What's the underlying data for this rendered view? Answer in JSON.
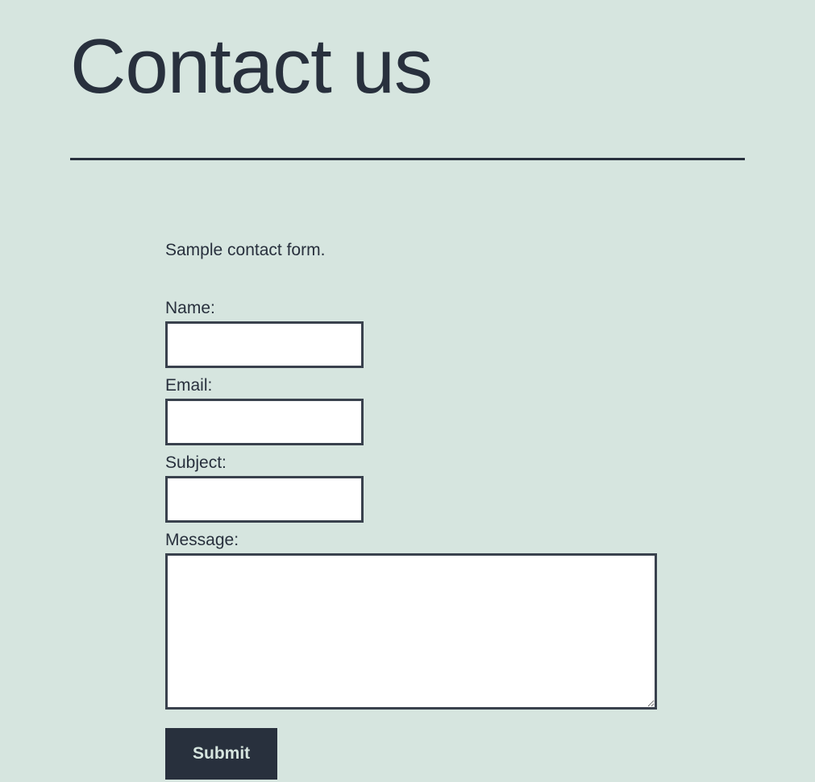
{
  "header": {
    "title": "Contact us"
  },
  "form": {
    "intro": "Sample contact form.",
    "fields": {
      "name": {
        "label": "Name:",
        "value": ""
      },
      "email": {
        "label": "Email:",
        "value": ""
      },
      "subject": {
        "label": "Subject:",
        "value": ""
      },
      "message": {
        "label": "Message:",
        "value": ""
      }
    },
    "submit_label": "Submit"
  }
}
